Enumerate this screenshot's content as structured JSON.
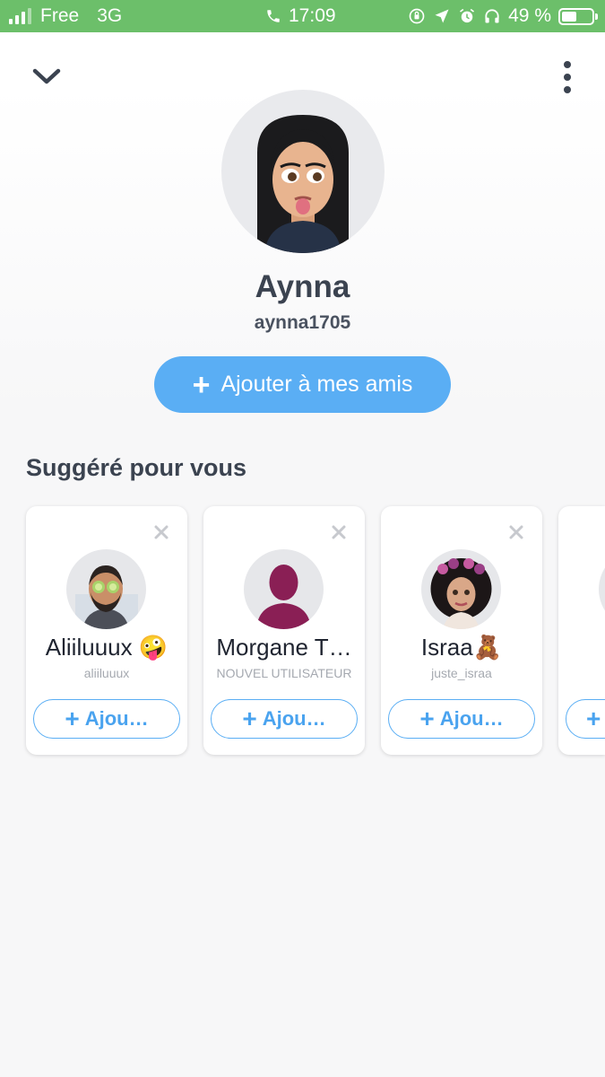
{
  "status_bar": {
    "carrier": "Free",
    "network": "3G",
    "time": "17:09",
    "battery": "49 %",
    "battery_level": 0.49
  },
  "header": {
    "collapse_icon": "chevron-down-icon",
    "more_icon": "more-vertical-icon"
  },
  "profile": {
    "name": "Aynna",
    "username": "aynna1705",
    "add_button_label": "Ajouter à mes amis"
  },
  "suggestions": {
    "title": "Suggéré pour vous",
    "cards": [
      {
        "name": "Aliiluuux 🤪",
        "subtitle": "aliiluuux",
        "button_label": "Ajou…"
      },
      {
        "name": "Morgane T…",
        "subtitle": "NOUVEL UTILISATEUR",
        "button_label": "Ajou…"
      },
      {
        "name": "Israa🧸",
        "subtitle": "juste_israa",
        "button_label": "Ajou…"
      }
    ]
  },
  "colors": {
    "status_bar": "#6cbf6a",
    "accent": "#5aaef4",
    "text_dark": "#3b4350"
  }
}
